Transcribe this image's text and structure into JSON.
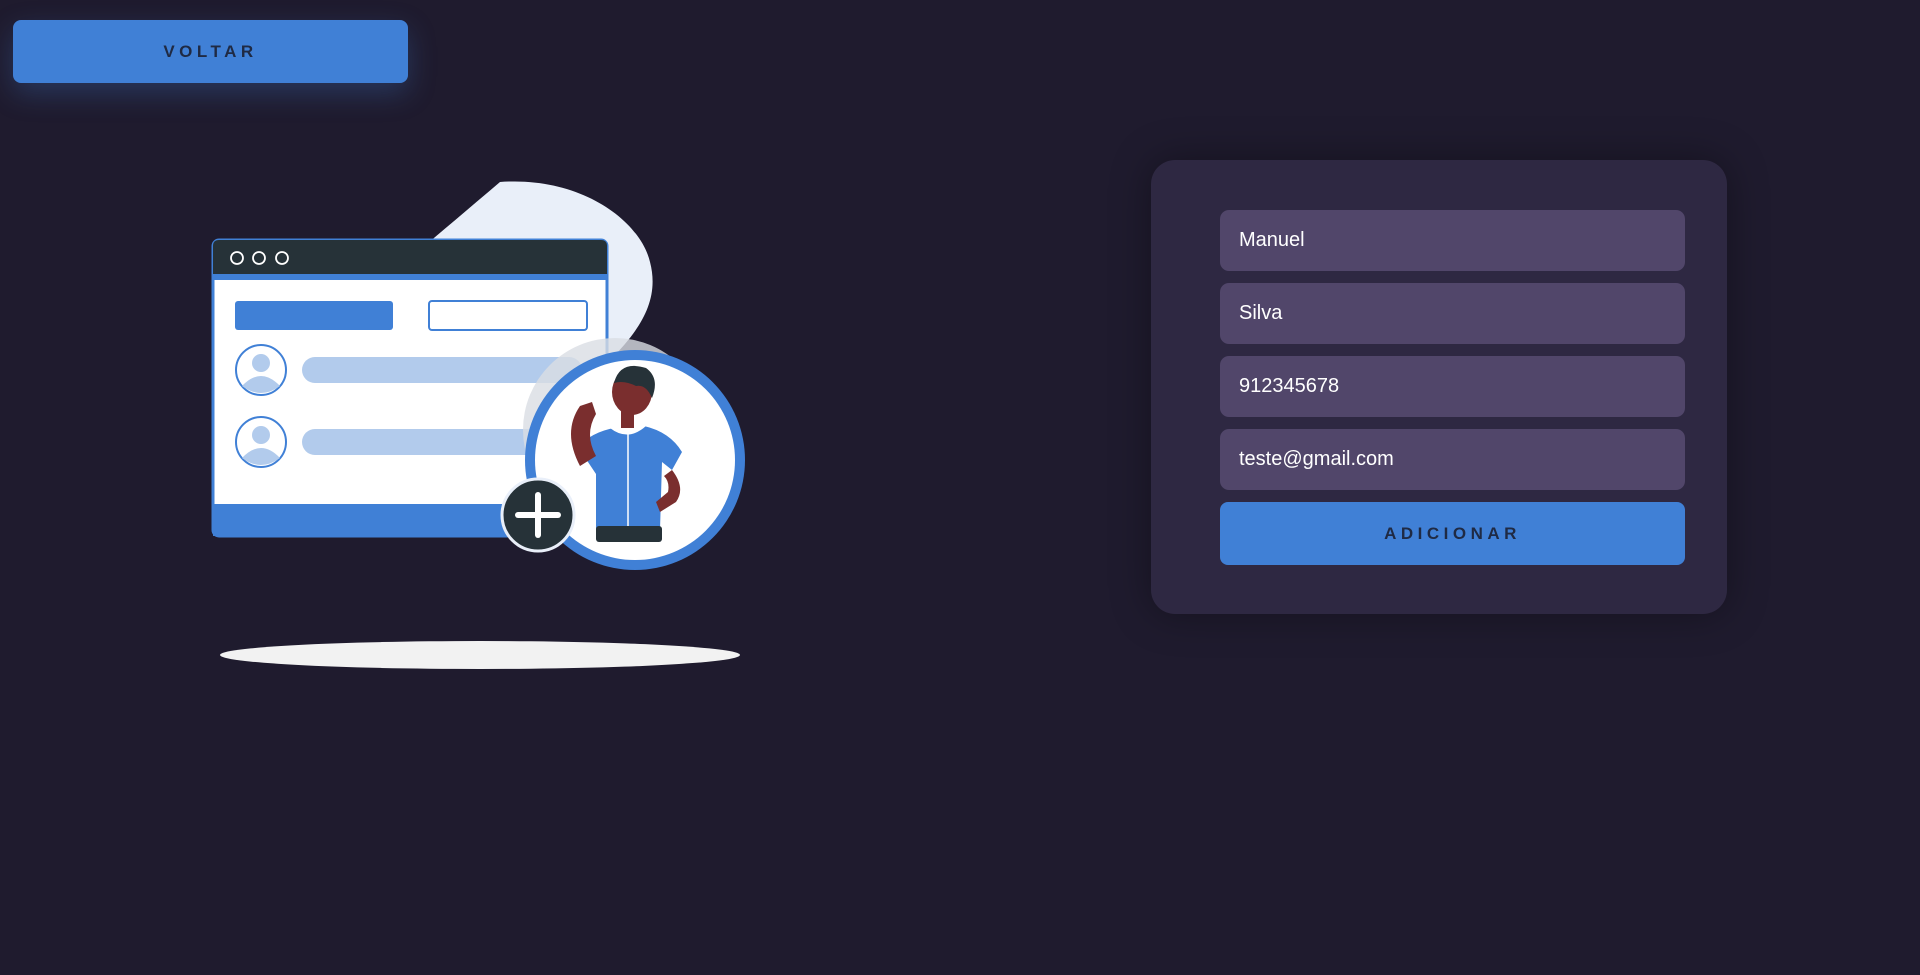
{
  "nav": {
    "back_label": "VOLTAR"
  },
  "form": {
    "first_name": {
      "value": "Manuel"
    },
    "last_name": {
      "value": "Silva"
    },
    "phone": {
      "value": "912345678"
    },
    "email": {
      "value": "teste@gmail.com"
    },
    "submit_label": "ADICIONAR"
  },
  "colors": {
    "background": "#1f1b2e",
    "accent": "#4080d6",
    "card": "#2e2842",
    "field": "#51466a"
  },
  "illustration": {
    "icons": [
      "browser-window-icon",
      "user-avatar-icon",
      "plus-icon",
      "person-figure"
    ]
  }
}
